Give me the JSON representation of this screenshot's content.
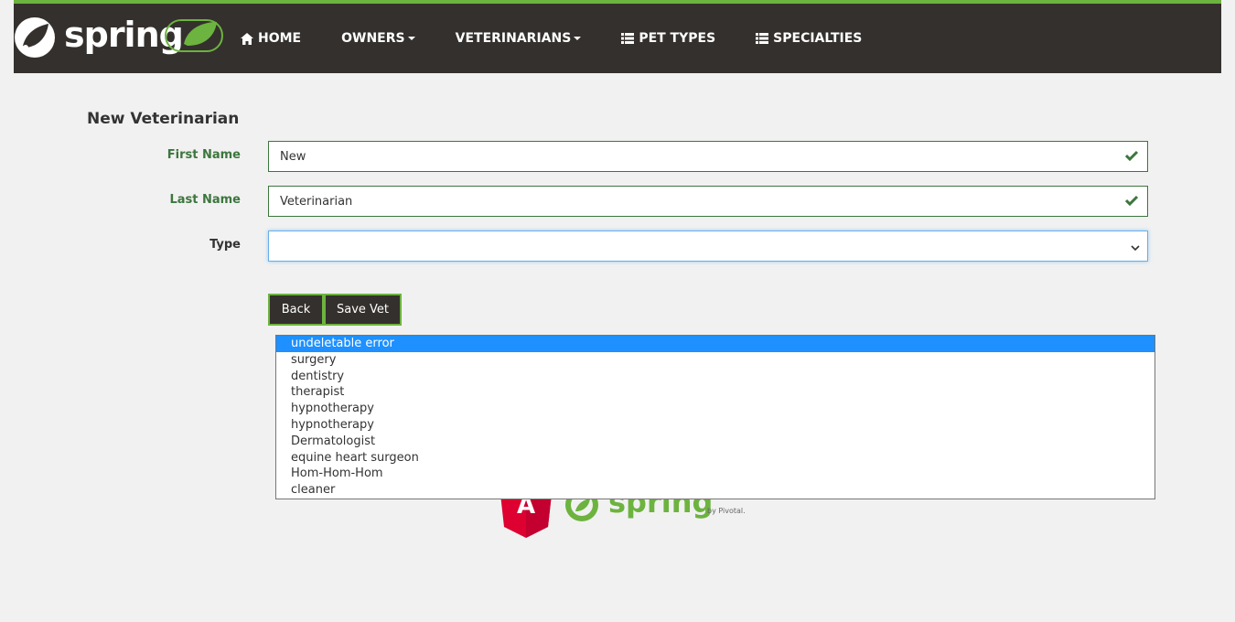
{
  "nav": {
    "brand": "spring",
    "items": [
      {
        "label": "HOME",
        "icon": "home-icon",
        "dropdown": false
      },
      {
        "label": "OWNERS",
        "icon": "",
        "dropdown": true
      },
      {
        "label": "VETERINARIANS",
        "icon": "",
        "dropdown": true
      },
      {
        "label": "PET TYPES",
        "icon": "list-icon",
        "dropdown": false
      },
      {
        "label": "SPECIALTIES",
        "icon": "list-icon",
        "dropdown": false
      }
    ]
  },
  "form": {
    "title": "New Veterinarian",
    "first_name_label": "First Name",
    "first_name_value": "New",
    "last_name_label": "Last Name",
    "last_name_value": "Veterinarian",
    "type_label": "Type",
    "type_value": "",
    "back_label": "Back",
    "save_label": "Save Vet"
  },
  "type_options": [
    "undeletable error",
    "surgery",
    "dentistry",
    "therapist",
    "hypnotherapy",
    "hypnotherapy",
    "Dermatologist",
    "equine heart surgeon",
    "Hom-Hom-Hom",
    "cleaner"
  ],
  "selected_option_index": 0,
  "footer": {
    "spring_text": "spring",
    "pivotal_text": "by Pivotal.",
    "angular_letter": "A"
  },
  "colors": {
    "nav_bg": "#34302d",
    "accent": "#6db33f",
    "valid": "#3c763d",
    "highlight": "#1e90ff"
  }
}
